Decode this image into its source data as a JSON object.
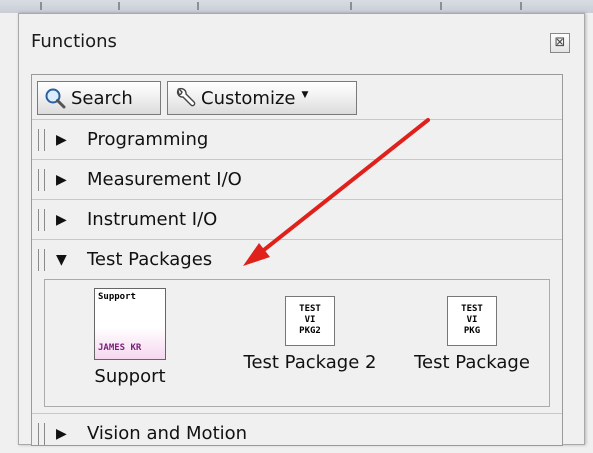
{
  "palette": {
    "title": "Functions",
    "toolbar": {
      "search_label": "Search",
      "customize_label": "Customize"
    },
    "categories": [
      {
        "label": "Programming",
        "expanded": false
      },
      {
        "label": "Measurement I/O",
        "expanded": false
      },
      {
        "label": "Instrument I/O",
        "expanded": false
      },
      {
        "label": "Test Packages",
        "expanded": true
      },
      {
        "label": "Vision and Motion",
        "expanded": false
      }
    ],
    "vis": [
      {
        "label": "Support",
        "icon_text_top": "Support",
        "icon_text_bottom": "JAMES KR",
        "icon": "support-vi-icon"
      },
      {
        "label": "Test Package 2",
        "icon_lines": [
          "TEST",
          "VI",
          "PKG2"
        ],
        "icon": "test-vi-icon"
      },
      {
        "label": "Test Package",
        "icon_lines": [
          "TEST",
          "VI",
          "PKG"
        ],
        "icon": "test-vi-icon"
      }
    ]
  },
  "annotation": {
    "color": "#e0201b",
    "points_to": "Test Packages"
  }
}
